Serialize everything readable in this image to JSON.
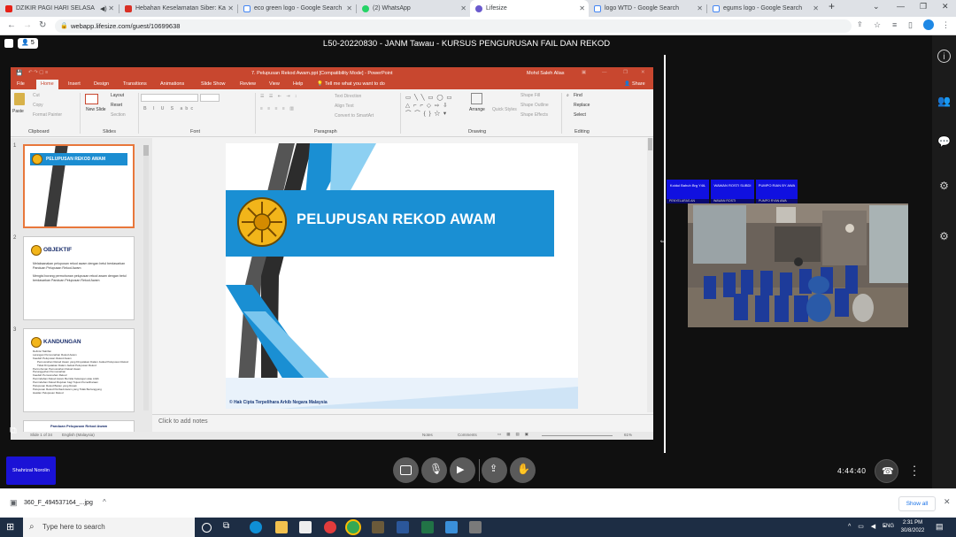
{
  "browser": {
    "tabs": [
      {
        "label": "DZIKIR PAGI HARI SELASA",
        "icon_color": "#e62117"
      },
      {
        "label": "Hebahan Keselamatan Siber: Ka",
        "icon_color": "#d93025"
      },
      {
        "label": "eco green logo - Google Search",
        "icon_color": "#4285f4"
      },
      {
        "label": "(2) WhatsApp",
        "icon_color": "#25d366"
      },
      {
        "label": "Lifesize",
        "icon_color": "#6a5acd"
      },
      {
        "label": "logo WTD - Google Search",
        "icon_color": "#4285f4"
      },
      {
        "label": "egums logo - Google Search",
        "icon_color": "#4285f4"
      }
    ],
    "url": "webapp.lifesize.com/guest/10699638"
  },
  "meeting": {
    "title": "L50-20220830 - JANM Tawau - KURSUS PENGURUSAN FAIL DAN REKOD",
    "participant_count": "5",
    "timer": "4:44:40",
    "presenter_name": "Shahrizal Norolin",
    "participant_chips": [
      {
        "label": "Koidui Bahuh Brg Y4iL",
        "bar": "PENYELARAS AN"
      },
      {
        "label": "WAWAN ROSTI SUBDI",
        "bar": "WAWAN ROSTI"
      },
      {
        "label": "PUMPO RIAN BY AWA",
        "bar": "PUMPO RYAN AWA"
      }
    ]
  },
  "powerpoint": {
    "window_title": "7. Pelupusan Rekod Awam.ppt [Compatibility Mode] - PowerPoint",
    "user": "Mohd Saleh Alias",
    "ribbon_tabs": [
      "File",
      "Home",
      "Insert",
      "Design",
      "Transitions",
      "Animations",
      "Slide Show",
      "Review",
      "View",
      "Help"
    ],
    "active_tab": "Home",
    "tell_me": "Tell me what you want to do",
    "share": "Share",
    "groups": {
      "clipboard": "Clipboard",
      "slides": "Slides",
      "font": "Font",
      "paragraph": "Paragraph",
      "drawing": "Drawing",
      "editing": "Editing"
    },
    "ribbon_labels": {
      "paste": "Paste",
      "cut": "Cut",
      "copy": "Copy",
      "format_painter": "Format Painter",
      "new_slide": "New Slide",
      "layout": "Layout",
      "reset": "Reset",
      "section": "Section",
      "text_direction": "Text Direction",
      "align_text": "Align Text",
      "convert_smartart": "Convert to SmartArt",
      "arrange": "Arrange",
      "quick_styles": "Quick Styles",
      "shape_fill": "Shape Fill",
      "shape_outline": "Shape Outline",
      "shape_effects": "Shape Effects",
      "find": "Find",
      "replace": "Replace",
      "select": "Select"
    },
    "thumbnails": [
      {
        "num": "1",
        "heading": "PELUPUSAN REKOD AWAM",
        "lines": []
      },
      {
        "num": "2",
        "heading": "OBJEKTIF",
        "lines": [
          "Melaksanakan pelupusan rekod awam dengan betul berdasarkan Panduan Pelupusan Rekod Awam",
          "Mengisi borang permohonan pelupusan rekod awam dengan betul berdasarkan Panduan Pelupusan Rekod Awam"
        ]
      },
      {
        "num": "3",
        "heading": "KANDUNGAN",
        "lines": [
          "Definisi Takrifan",
          "Larangan Pemusnahan Rekod Awam",
          "Kaedah Pelupusan Rekod Awam",
          "Pemusnahan Rekod Awam yang Dinyatakan Dalam Jadual Pelupusan Rekod",
          "Tidak Dinyatakan Dalam Jadual Pelupusan Rekod",
          "Permohonan Pemusnahan Rekod Awam",
          "Penangguhan Pemusnahan",
          "Kaedah Pemusnahan Rekod",
          "Pemindahan Rekod Awam Bernilai Kekangan atau Arkib",
          "Pemindahan Rekod Rujukan bagi Tujuan Pemeliharaan",
          "Pelupusan Rekod Bukan yang Rosak",
          "Pelupusan Rekod Peribadi Awam yang Tidak Bertanggung",
          "Hasilan Pelupusan Rekod"
        ]
      }
    ],
    "thumb4_heading": "Panduan Pelupusan Rekod Awam",
    "slide_title": "PELUPUSAN REKOD AWAM",
    "slide_footer": "© Hak Cipta Terpelihara Arkib Negara Malaysia",
    "notes_placeholder": "Click to add notes",
    "status": {
      "slide_count": "Slide 1 of 34",
      "language": "English (Malaysia)",
      "notes": "Notes",
      "comments": "Comments",
      "zoom": "61%"
    }
  },
  "download": {
    "filename": "360_F_494537164_...jpg",
    "show_all": "Show all"
  },
  "taskbar": {
    "search_placeholder": "Type here to search",
    "time": "2:31 PM",
    "date": "30/8/2022",
    "lang": "ENG"
  }
}
